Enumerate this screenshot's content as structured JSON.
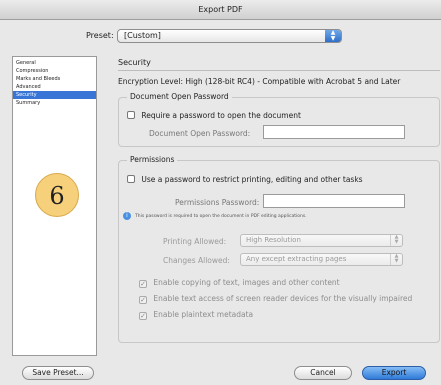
{
  "window": {
    "title": "Export PDF"
  },
  "preset": {
    "label": "Preset:",
    "value": "[Custom]"
  },
  "sidebar": {
    "items": [
      {
        "label": "General",
        "selected": false
      },
      {
        "label": "Compression",
        "selected": false
      },
      {
        "label": "Marks and Bleeds",
        "selected": false
      },
      {
        "label": "Advanced",
        "selected": false
      },
      {
        "label": "Security",
        "selected": true
      },
      {
        "label": "Summary",
        "selected": false
      }
    ]
  },
  "badge": {
    "number": "6",
    "color": "#f6d07a"
  },
  "security": {
    "heading": "Security",
    "encryption_level": "Encryption Level: High (128-bit RC4) - Compatible with Acrobat 5 and Later",
    "open_password": {
      "group_title": "Document Open Password",
      "require_label": "Require a password to open the document",
      "require_checked": false,
      "field_label": "Document Open Password:",
      "field_value": ""
    },
    "permissions": {
      "group_title": "Permissions",
      "restrict_label": "Use a password to restrict printing, editing and other tasks",
      "restrict_checked": false,
      "field_label": "Permissions Password:",
      "field_value": "",
      "info_text": "This password is required to open the document in PDF editing applications.",
      "printing_label": "Printing Allowed:",
      "printing_value": "High Resolution",
      "changes_label": "Changes Allowed:",
      "changes_value": "Any except extracting pages",
      "enable_copying_label": "Enable copying of text, images and other content",
      "enable_screen_reader_label": "Enable text access of screen reader devices for the visually impaired",
      "enable_plaintext_label": "Enable plaintext metadata"
    }
  },
  "footer": {
    "save_preset_label": "Save Preset...",
    "cancel_label": "Cancel",
    "export_label": "Export"
  },
  "colors": {
    "accent": "#3875d7",
    "primary_button": "#2f7ad9"
  }
}
